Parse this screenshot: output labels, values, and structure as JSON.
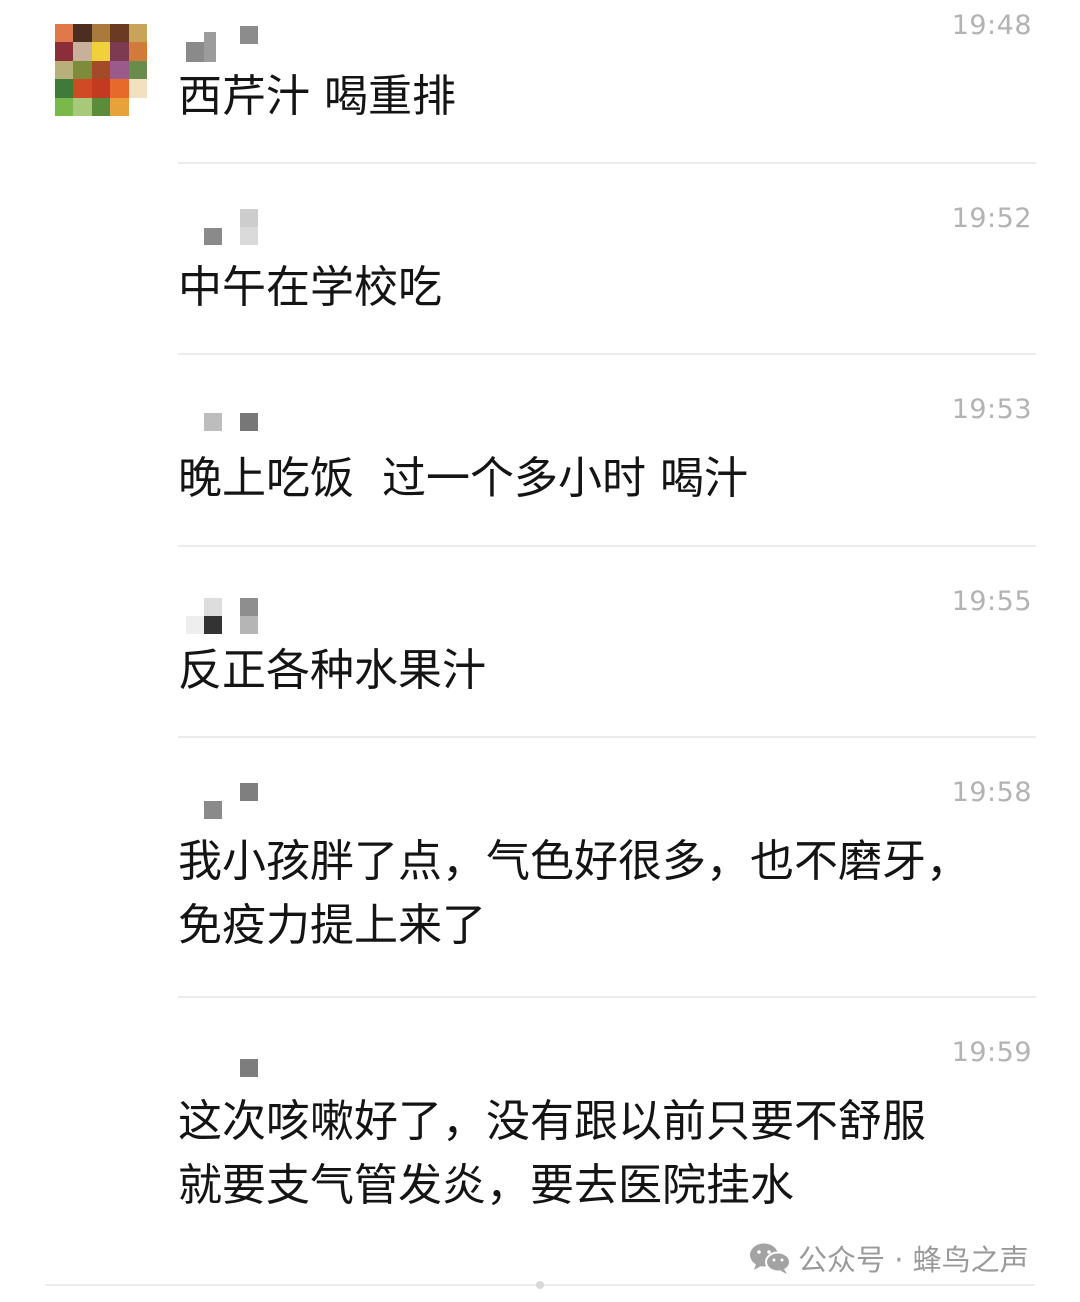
{
  "messages": [
    {
      "time": "19:48",
      "text": "西芹汁 喝重排"
    },
    {
      "time": "19:52",
      "text": "中午在学校吃"
    },
    {
      "time": "19:53",
      "text": "晚上吃饭  过一个多小时 喝汁"
    },
    {
      "time": "19:55",
      "text": "反正各种水果汁"
    },
    {
      "time": "19:58",
      "text": "我小孩胖了点，气色好很多，也不磨牙，\n免疫力提上来了"
    },
    {
      "time": "19:59",
      "text": "这次咳嗽好了，没有跟以前只要不舒服\n就要支气管发炎，要去医院挂水"
    }
  ],
  "watermark": {
    "text": "公众号 · 蜂鸟之声",
    "icon": "wechat-logo-icon"
  },
  "avatar": {
    "icon": "pixelated-avatar-icon"
  }
}
